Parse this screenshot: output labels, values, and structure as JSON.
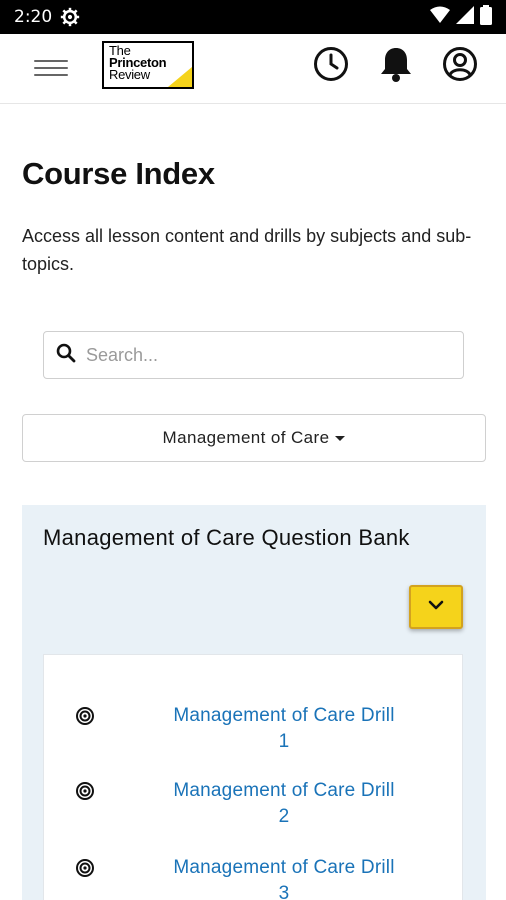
{
  "status_bar": {
    "time": "2:20"
  },
  "header": {
    "logo": {
      "line1": "The",
      "line2": "Princeton",
      "line3": "Review"
    }
  },
  "page": {
    "title": "Course Index",
    "description": "Access all lesson content and drills by subjects and sub-topics."
  },
  "search": {
    "placeholder": "Search..."
  },
  "filter": {
    "selected": "Management of Care"
  },
  "bank": {
    "title": "Management of Care Question Bank",
    "drills": [
      {
        "line1": "Management of Care Drill",
        "line2": "1"
      },
      {
        "line1": "Management of Care Drill",
        "line2": "2"
      },
      {
        "line1": "Management of Care Drill",
        "line2": "3"
      }
    ]
  },
  "colors": {
    "accent_yellow": "#f5d31b",
    "link_blue": "#1a73b8",
    "panel_bg": "#e9f1f7"
  }
}
